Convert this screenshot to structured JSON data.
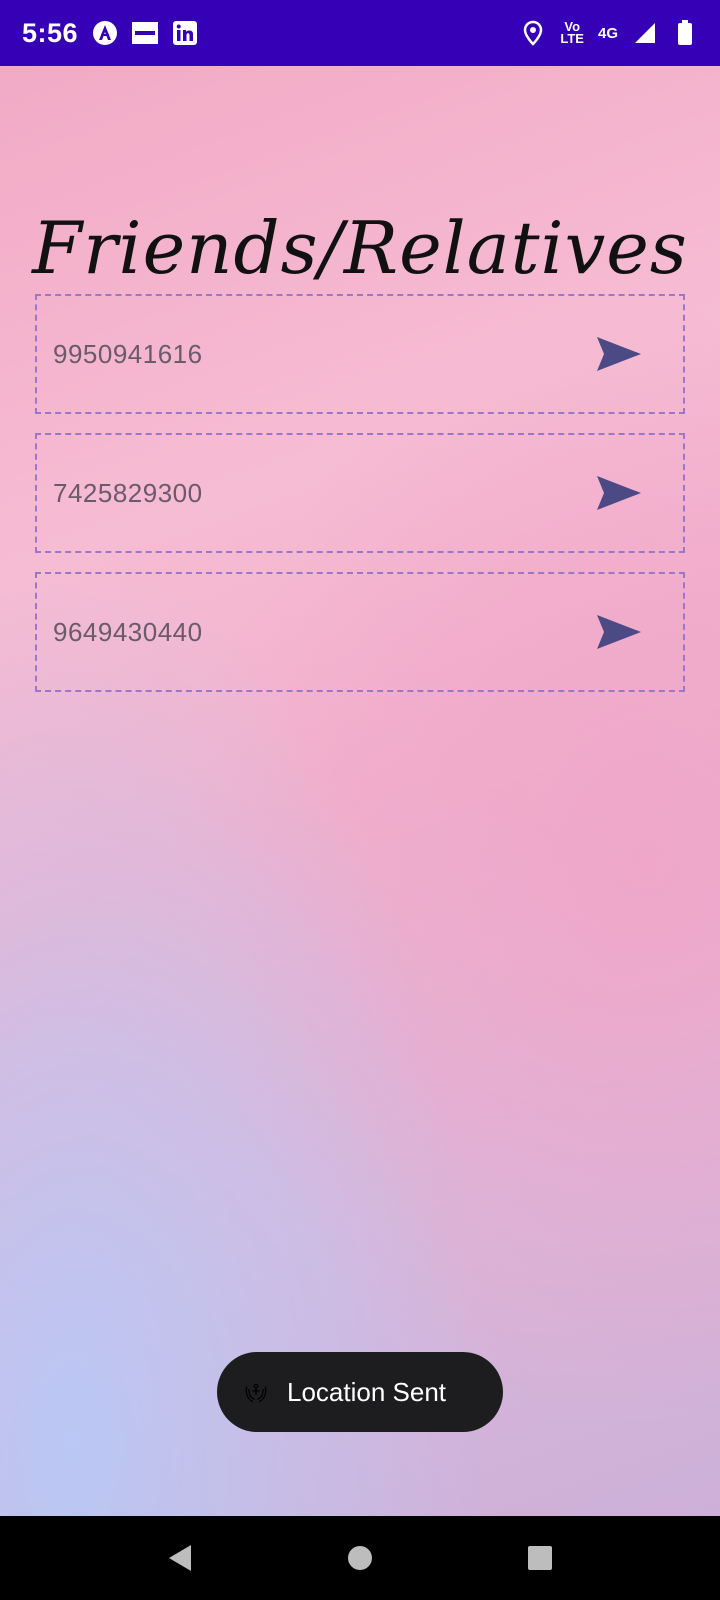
{
  "status_bar": {
    "time": "5:56",
    "icons": [
      "accessibility-icon",
      "zomato-icon",
      "linkedin-icon"
    ],
    "right": {
      "net_top": "Vo",
      "net_bottom": "LTE",
      "network": "4G"
    }
  },
  "page": {
    "title": "Friends/Relatives"
  },
  "contacts": [
    {
      "phone": "9950941616"
    },
    {
      "phone": "7425829300"
    },
    {
      "phone": "9649430440"
    }
  ],
  "toast": {
    "text": "Location Sent"
  },
  "colors": {
    "status_bar": "#3500b6",
    "send_icon": "#4b4a85",
    "dash_border": "#9a78c7",
    "toast_bg": "#1d1d1f"
  }
}
